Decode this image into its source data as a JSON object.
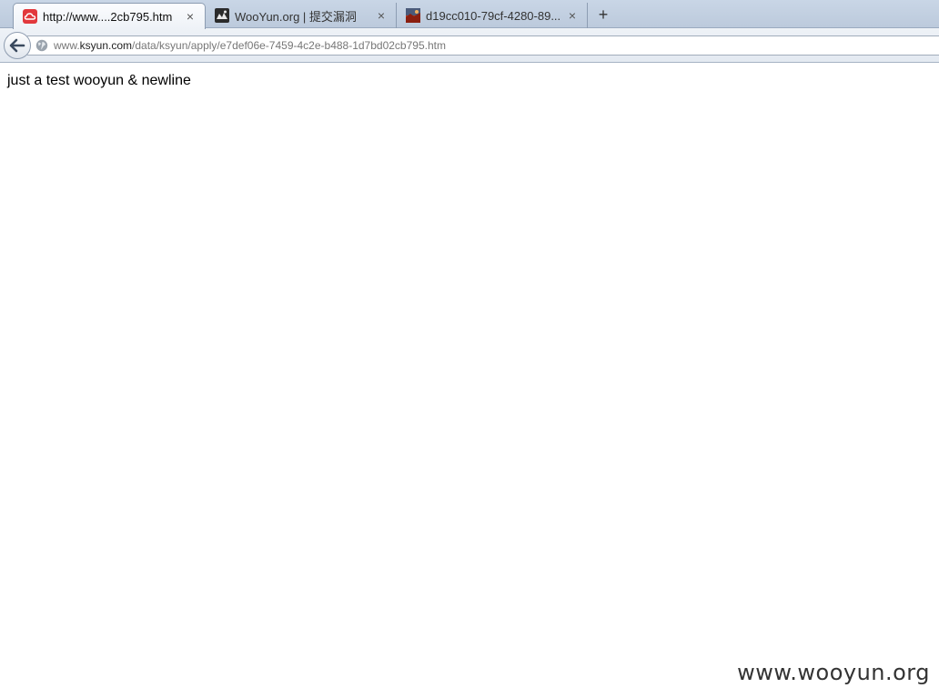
{
  "tabs": [
    {
      "title": "http://www....2cb795.htm",
      "favicon": "ksyun-cloud-icon",
      "active": true
    },
    {
      "title": "WooYun.org | 提交漏洞",
      "favicon": "wooyun-logo-icon",
      "active": false
    },
    {
      "title": "d19cc010-79cf-4280-89...",
      "favicon": "image-thumbnail-icon",
      "active": false
    }
  ],
  "tab_close_glyph": "×",
  "new_tab_glyph": "+",
  "urlbar": {
    "prefix": "www.",
    "domain": "ksyun.com",
    "path": "/data/ksyun/apply/e7def06e-7459-4c2e-b488-1d7bd02cb795.htm"
  },
  "page": {
    "body_text": "just a test wooyun & newline"
  },
  "watermark": "www.wooyun.org",
  "colors": {
    "ksyun_red": "#e2383c",
    "tabstrip_bg": "#c9d6e6"
  }
}
